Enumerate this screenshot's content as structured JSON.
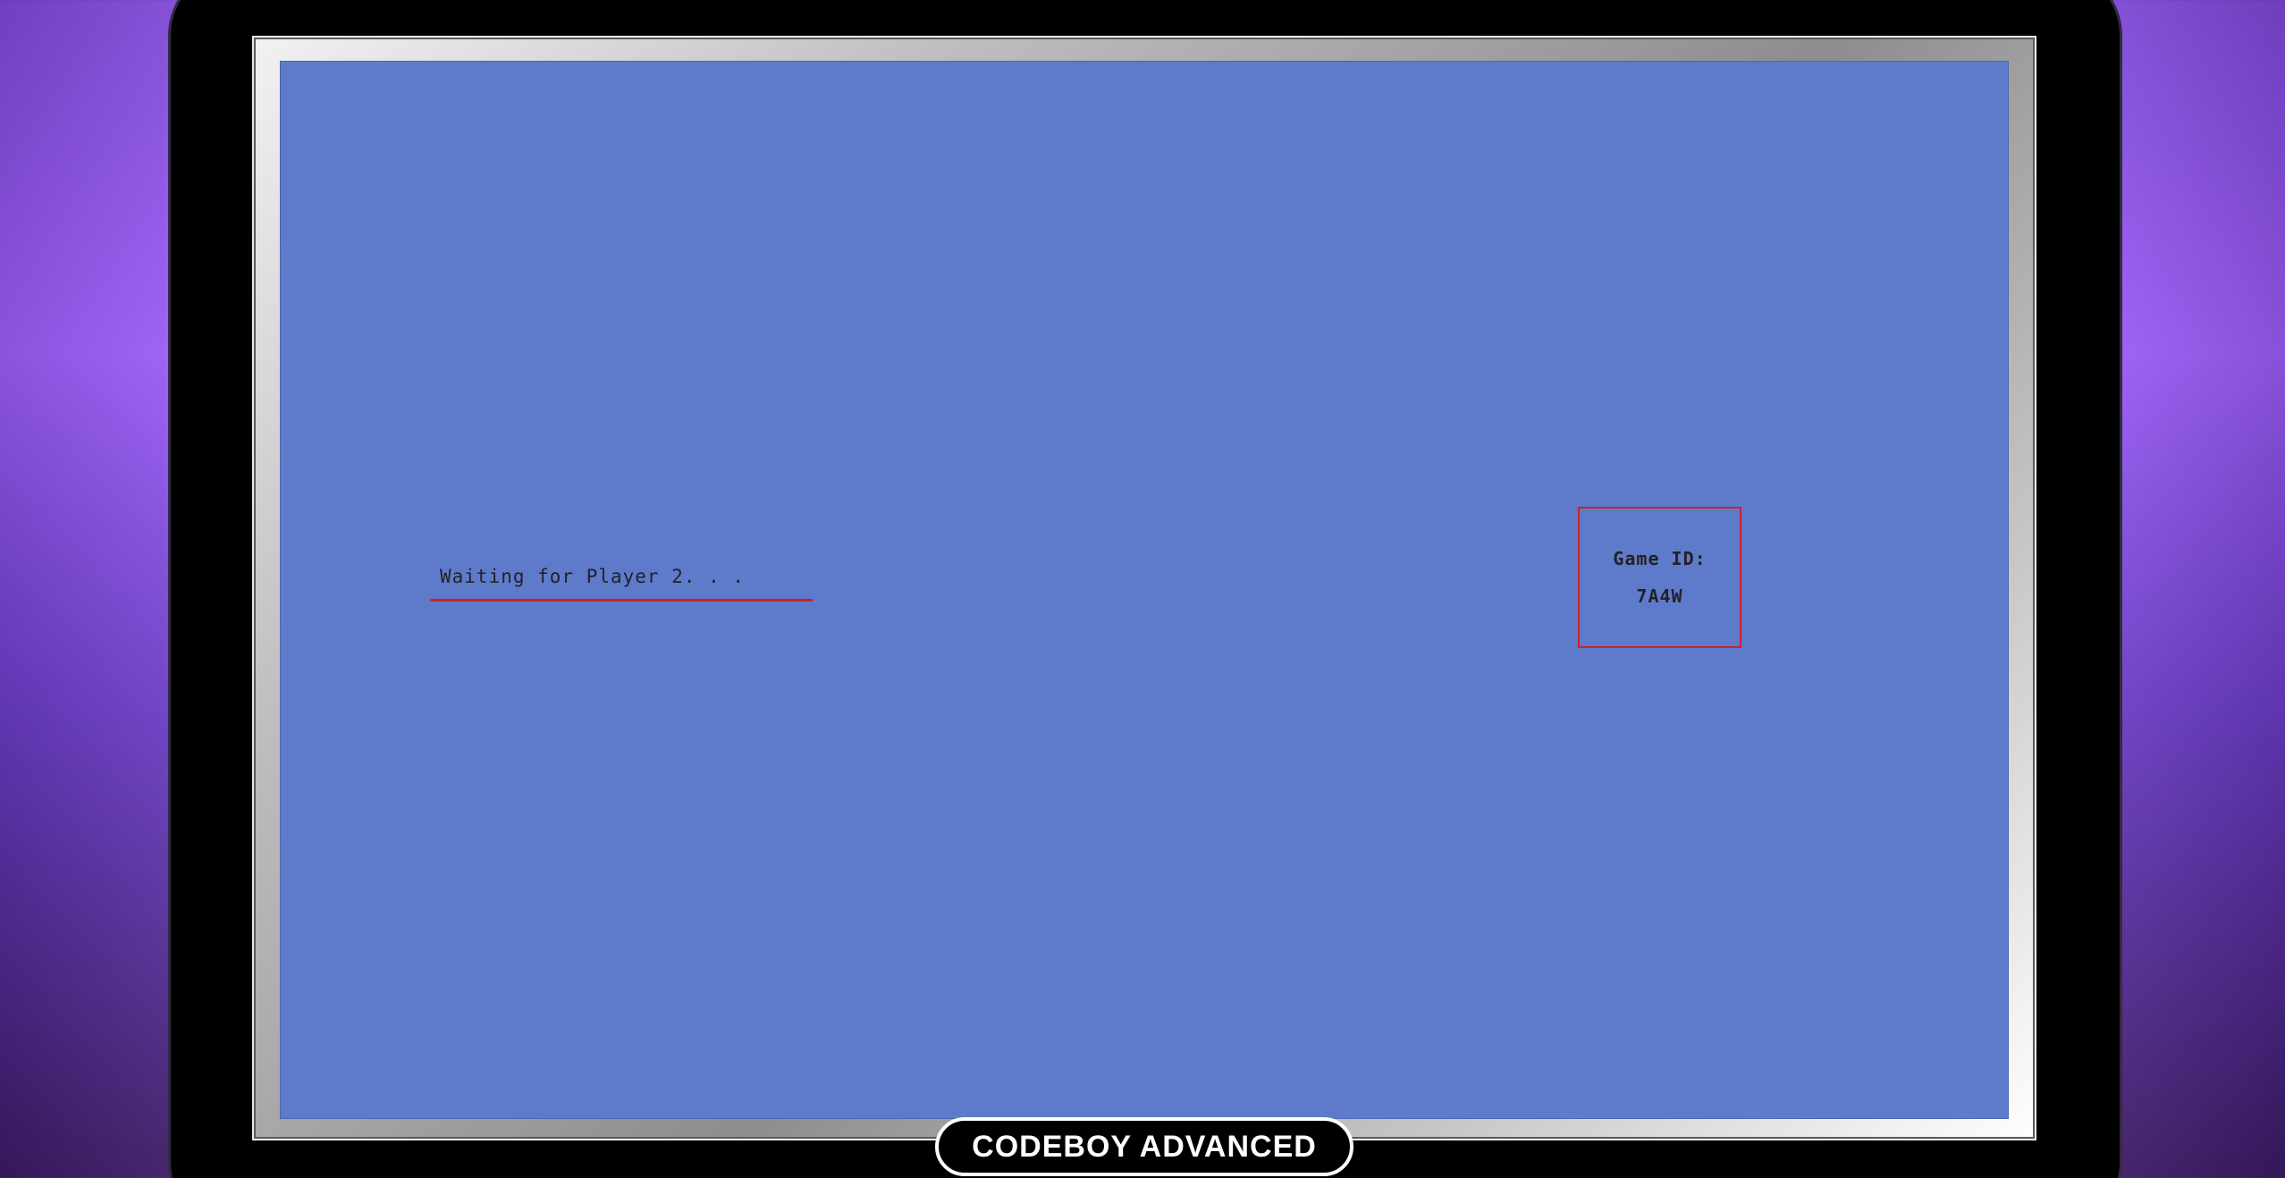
{
  "game": {
    "status_text": "Waiting for Player 2. . .",
    "game_id_label": "Game ID:",
    "game_id_value": "7A4W"
  },
  "device": {
    "brand": "CODEBOY ADVANCED"
  },
  "colors": {
    "screen_background": "#5e7bcb",
    "highlight_red": "#d21f2a",
    "device_body": "#000000",
    "background_purple": "#9a5cf6"
  }
}
